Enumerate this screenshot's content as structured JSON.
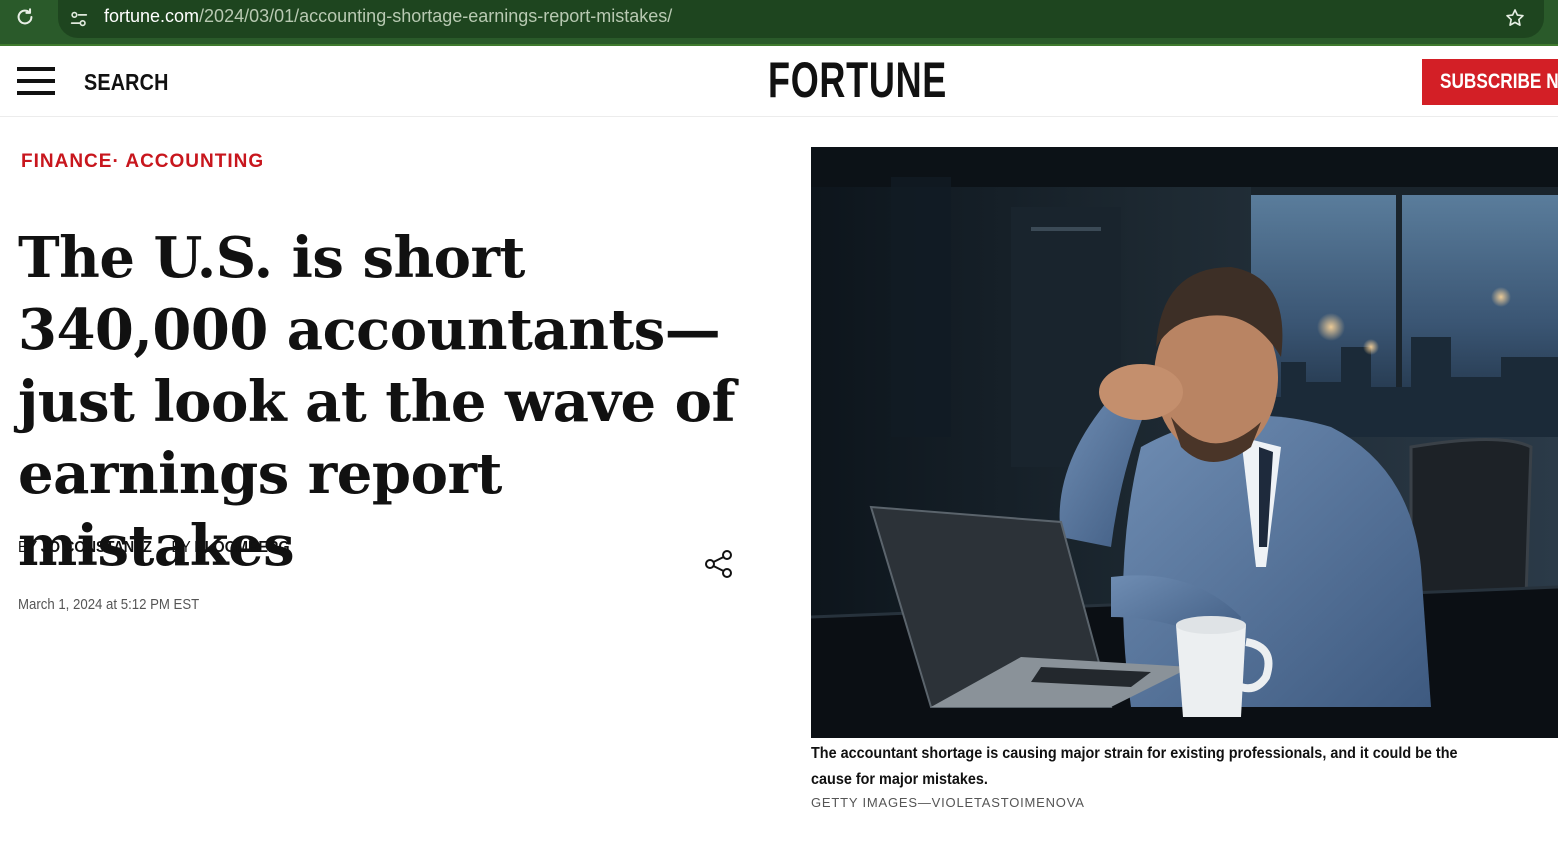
{
  "browser": {
    "url_domain": "fortune.com",
    "url_path": "/2024/03/01/accounting-shortage-earnings-report-mistakes/"
  },
  "header": {
    "search_label": "SEARCH",
    "logo": "FORTUNE",
    "subscribe_label": "SUBSCRIBE NOW"
  },
  "article": {
    "categories": [
      "FINANCE",
      "ACCOUNTING"
    ],
    "category_separator": "·",
    "headline": "The U.S. is short 340,000 accountants—just look at the wave of earnings report mistakes",
    "bylines": [
      {
        "prefix": "BY",
        "author": "JO CONSTANTZ"
      },
      {
        "prefix": "BY",
        "author": "BLOOMBERG"
      }
    ],
    "date": "March 1, 2024 at 5:12 PM EST",
    "image": {
      "caption": "The accountant shortage is causing major strain for existing professionals, and it could be the cause for major mistakes.",
      "credit": "GETTY IMAGES—VIOLETASTOIMENOVA"
    }
  },
  "colors": {
    "browser_bar": "#2a5a2a",
    "accent_red": "#d31f26",
    "text_dark": "#111111"
  },
  "icons": [
    "reload-icon",
    "site-settings-icon",
    "star-icon",
    "hamburger-menu-icon",
    "share-icon"
  ]
}
